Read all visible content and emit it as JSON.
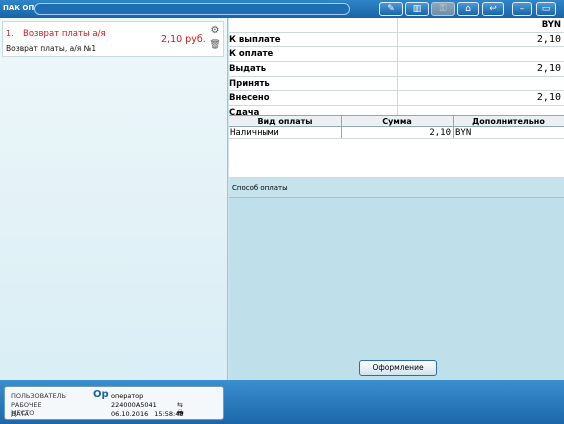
{
  "app": {
    "title": "ПАК ОПС"
  },
  "toolbar": {
    "buttons": [
      {
        "name": "broom-icon",
        "glyph": "✎"
      },
      {
        "name": "barcode-icon",
        "glyph": "▥"
      },
      {
        "name": "key-icon",
        "glyph": "⚿"
      },
      {
        "name": "home-icon",
        "glyph": "⌂"
      },
      {
        "name": "back-icon",
        "glyph": "↩"
      },
      {
        "name": "minimize-icon",
        "glyph": "–"
      },
      {
        "name": "maximize-icon",
        "glyph": "▭"
      }
    ]
  },
  "cart": {
    "item": {
      "number": "1.",
      "title": "Возврат платы а/я",
      "price": "2,10 руб.",
      "subtitle": "Возврат платы, а/я №1"
    }
  },
  "summary": {
    "currency": "BYN",
    "rows": [
      {
        "label": "К выплате",
        "value": "2,10"
      },
      {
        "label": "К оплате",
        "value": ""
      },
      {
        "label": "Выдать",
        "value": "2,10"
      },
      {
        "label": "Принять",
        "value": ""
      },
      {
        "label": "Внесено",
        "value": "2,10"
      },
      {
        "label": "Сдача",
        "value": ""
      }
    ]
  },
  "payments": {
    "headers": [
      "Вид оплаты",
      "Сумма",
      "Дополнительно"
    ],
    "rows": [
      {
        "type": "Наличными",
        "amount": "2,10",
        "extra": "BYN"
      }
    ]
  },
  "payment_method": {
    "label": "Способ оплаты"
  },
  "actions": {
    "checkout_label": "Оформление"
  },
  "status": {
    "user_label": "ПОЛЬЗОВАТЕЛЬ",
    "user_icon": "Ор",
    "user_value": "оператор",
    "workplace_label": "РАБОЧЕЕ МЕСТО",
    "workplace_value": "224000А5041",
    "date_label": "ДАТА",
    "date_value": "06.10.2016",
    "time_value": "15:58:48"
  },
  "colors": {
    "accent": "#1a62a6",
    "item_text": "#d01818",
    "panel_bg": "#bfe0ea"
  }
}
